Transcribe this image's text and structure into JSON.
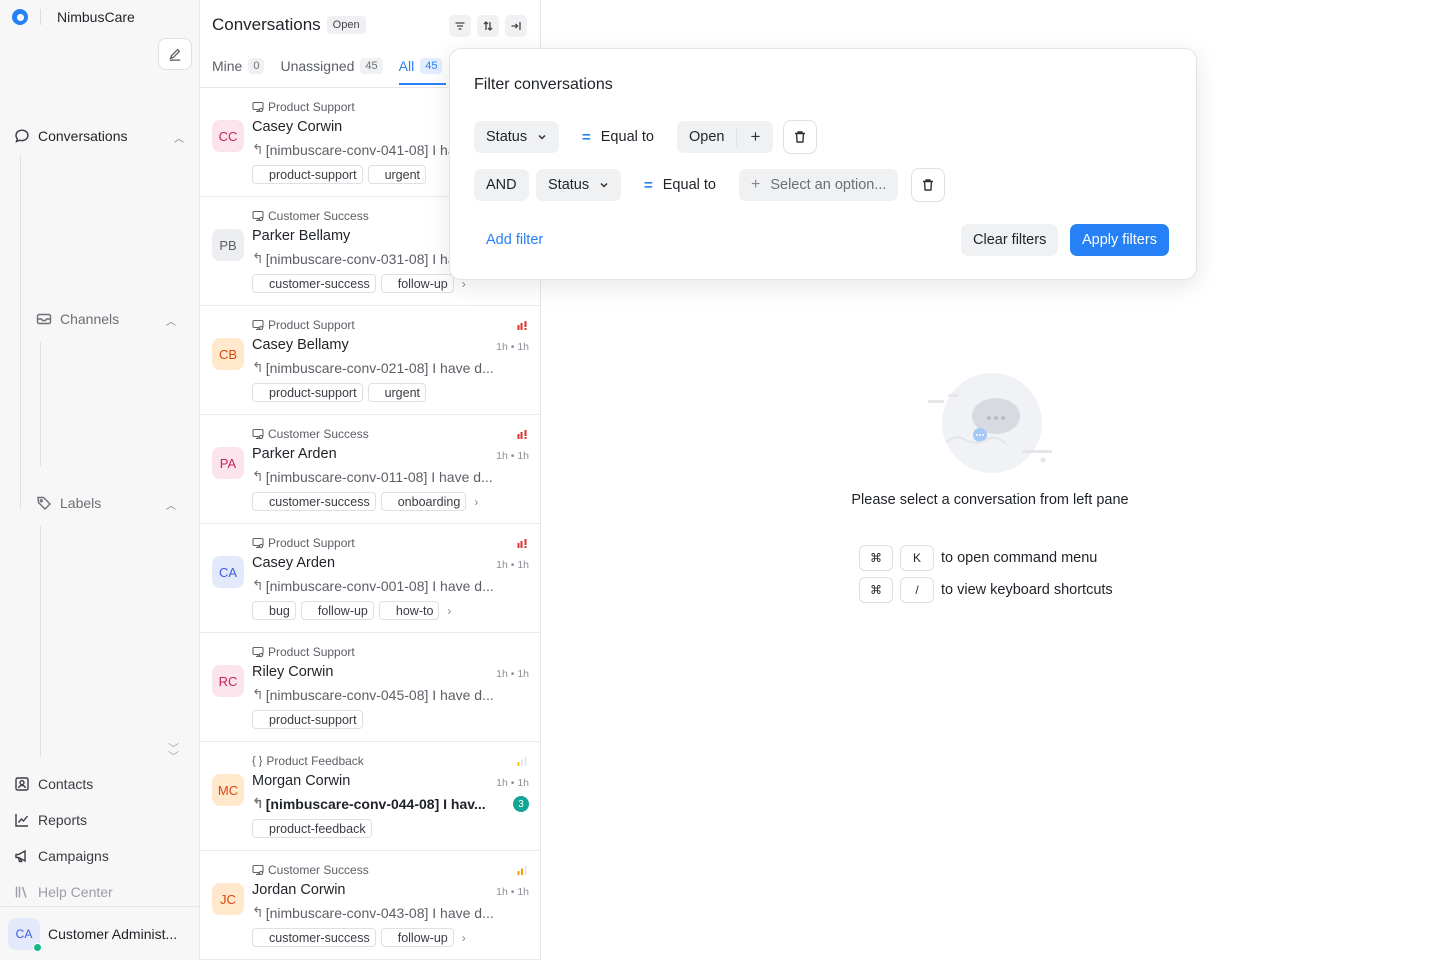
{
  "app": {
    "name": "NimbusCare"
  },
  "sidebar": {
    "groups": [
      {
        "label": "Conversations",
        "icon": "chat-bubble-icon"
      },
      {
        "label": "Channels",
        "icon": "inbox-icon"
      },
      {
        "label": "Labels",
        "icon": "tag-icon"
      }
    ],
    "bottom_items": [
      {
        "label": "Contacts",
        "icon": "contacts-icon"
      },
      {
        "label": "Reports",
        "icon": "chart-line-icon"
      },
      {
        "label": "Campaigns",
        "icon": "megaphone-icon"
      },
      {
        "label": "Help Center",
        "icon": "library-icon"
      }
    ],
    "user": {
      "initials": "CA",
      "name": "Customer Administ..."
    }
  },
  "conversations": {
    "title": "Conversations",
    "status_badge": "Open",
    "tabs": [
      {
        "label": "Mine",
        "count": "0"
      },
      {
        "label": "Unassigned",
        "count": "45"
      },
      {
        "label": "All",
        "count": "45"
      }
    ],
    "items": [
      {
        "initials": "CC",
        "inbox": "Product Support",
        "name": "Casey Corwin",
        "time": "",
        "message": "[nimbuscare-conv-041-08] I have d...",
        "labels": [
          "product-support",
          "urgent"
        ],
        "avatar_bg": "#fce4ec",
        "avatar_fg": "#c2255c",
        "priority": ""
      },
      {
        "initials": "PB",
        "inbox": "Customer Success",
        "name": "Parker Bellamy",
        "time": "",
        "message": "[nimbuscare-conv-031-08] I have d...",
        "labels": [
          "customer-success",
          "follow-up"
        ],
        "more": "›",
        "avatar_bg": "#eceef1",
        "avatar_fg": "#5b5f66",
        "priority": ""
      },
      {
        "initials": "CB",
        "inbox": "Product Support",
        "name": "Casey Bellamy",
        "time": "1h • 1h",
        "message": "[nimbuscare-conv-021-08] I have d...",
        "labels": [
          "product-support",
          "urgent"
        ],
        "avatar_bg": "#ffe8cc",
        "avatar_fg": "#d9480f",
        "priority": "urgent"
      },
      {
        "initials": "PA",
        "inbox": "Customer Success",
        "name": "Parker Arden",
        "time": "1h • 1h",
        "message": "[nimbuscare-conv-011-08] I have d...",
        "labels": [
          "customer-success",
          "onboarding"
        ],
        "more": "›",
        "avatar_bg": "#fce4ec",
        "avatar_fg": "#c2255c",
        "priority": "urgent"
      },
      {
        "initials": "CA",
        "inbox": "Product Support",
        "name": "Casey Arden",
        "time": "1h • 1h",
        "message": "[nimbuscare-conv-001-08] I have d...",
        "labels": [
          "bug",
          "follow-up",
          "how-to"
        ],
        "more": "›",
        "avatar_bg": "#e3e9fb",
        "avatar_fg": "#3b5bdb",
        "priority": "urgent"
      },
      {
        "initials": "RC",
        "inbox": "Product Support",
        "name": "Riley Corwin",
        "time": "1h • 1h",
        "message": "[nimbuscare-conv-045-08] I have d...",
        "labels": [
          "product-support"
        ],
        "avatar_bg": "#fce4ec",
        "avatar_fg": "#c2255c",
        "priority": ""
      },
      {
        "initials": "MC",
        "inbox": "Product Feedback",
        "name": "Morgan Corwin",
        "time": "1h • 1h",
        "message": "[nimbuscare-conv-044-08] I hav...",
        "labels": [
          "product-feedback"
        ],
        "avatar_bg": "#ffe8cc",
        "avatar_fg": "#d9480f",
        "priority": "low",
        "unread": "3",
        "bold": true,
        "inbox_icon": "braces"
      },
      {
        "initials": "JC",
        "inbox": "Customer Success",
        "name": "Jordan Corwin",
        "time": "1h • 1h",
        "message": "[nimbuscare-conv-043-08] I have d...",
        "labels": [
          "customer-success",
          "follow-up"
        ],
        "more": "›",
        "avatar_bg": "#ffe8cc",
        "avatar_fg": "#d9480f",
        "priority": "medium"
      }
    ]
  },
  "filter": {
    "title": "Filter conversations",
    "rows": [
      {
        "attribute": "Status",
        "operator": "Equal to",
        "value": "Open"
      },
      {
        "conjunction": "AND",
        "attribute": "Status",
        "operator": "Equal to",
        "value_placeholder": "Select an option..."
      }
    ],
    "add_filter": "Add filter",
    "clear": "Clear filters",
    "apply": "Apply filters"
  },
  "empty_state": {
    "message": "Please select a conversation from left pane",
    "shortcuts": [
      {
        "keys": [
          "⌘",
          "K"
        ],
        "desc": "to open command menu"
      },
      {
        "keys": [
          "⌘",
          "/"
        ],
        "desc": "to view keyboard shortcuts"
      }
    ]
  },
  "colors": {
    "accent": "#2781f6",
    "priority_urgent": "#e03131",
    "priority_medium": "#f59f00",
    "priority_low": "#fcc419",
    "unread": "#12a594"
  }
}
